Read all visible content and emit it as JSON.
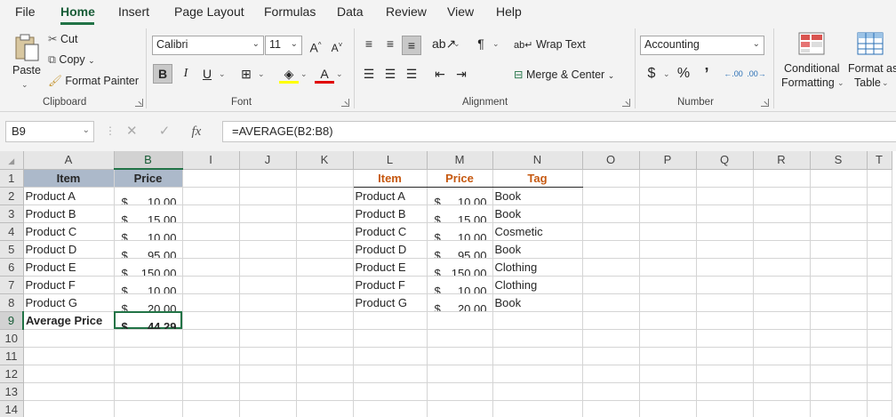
{
  "menu": {
    "tabs": [
      "File",
      "Home",
      "Insert",
      "Page Layout",
      "Formulas",
      "Data",
      "Review",
      "View",
      "Help"
    ],
    "active": "Home"
  },
  "ribbon": {
    "clipboard": {
      "paste": "Paste",
      "cut": "Cut",
      "copy": "Copy",
      "format_painter": "Format Painter",
      "label": "Clipboard"
    },
    "font": {
      "family": "Calibri",
      "size": "11",
      "bold": "B",
      "italic": "I",
      "underline": "U",
      "label": "Font"
    },
    "alignment": {
      "wrap_text": "Wrap Text",
      "merge_center": "Merge & Center",
      "label": "Alignment"
    },
    "number": {
      "format": "Accounting",
      "currency": "$",
      "percent": "%",
      "comma": "’",
      "label": "Number"
    },
    "styles": {
      "conditional": "Conditional",
      "formatting": "Formatting",
      "format_as": "Format as",
      "table": "Table"
    }
  },
  "formula_bar": {
    "name_box": "B9",
    "formula": "=AVERAGE(B2:B8)"
  },
  "grid": {
    "columns": [
      "A",
      "B",
      "I",
      "J",
      "K",
      "L",
      "M",
      "N",
      "O",
      "P",
      "Q",
      "R",
      "S",
      "T"
    ],
    "rows": [
      "1",
      "2",
      "3",
      "4",
      "5",
      "6",
      "7",
      "8",
      "9",
      "10",
      "11",
      "12",
      "13",
      "14"
    ],
    "left_table": {
      "headers": [
        "Item",
        "Price"
      ],
      "rows": [
        [
          "Product A",
          "$",
          "10.00"
        ],
        [
          "Product B",
          "$",
          "15.00"
        ],
        [
          "Product C",
          "$",
          "10.00"
        ],
        [
          "Product D",
          "$",
          "95.00"
        ],
        [
          "Product E",
          "$",
          "150.00"
        ],
        [
          "Product F",
          "$",
          "10.00"
        ],
        [
          "Product G",
          "$",
          "20.00"
        ]
      ],
      "footer": [
        "Average Price",
        "$",
        "44.29"
      ]
    },
    "right_table": {
      "headers": [
        "Item",
        "Price",
        "Tag"
      ],
      "rows": [
        [
          "Product A",
          "$",
          "10.00",
          "Book"
        ],
        [
          "Product B",
          "$",
          "15.00",
          "Book"
        ],
        [
          "Product C",
          "$",
          "10.00",
          "Cosmetic"
        ],
        [
          "Product D",
          "$",
          "95.00",
          "Book"
        ],
        [
          "Product E",
          "$",
          "150.00",
          "Clothing"
        ],
        [
          "Product F",
          "$",
          "10.00",
          "Clothing"
        ],
        [
          "Product G",
          "$",
          "20.00",
          "Book"
        ]
      ]
    }
  },
  "colors": {
    "accent": "#217346",
    "header_fill": "#acb9ca",
    "header_text_orange": "#c65911"
  }
}
